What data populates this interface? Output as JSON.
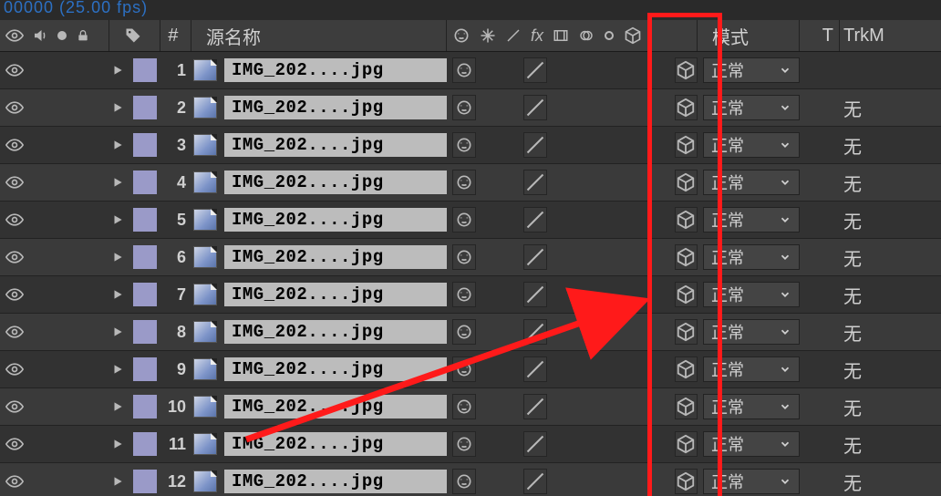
{
  "timecode": "00000 (25.00 fps)",
  "header": {
    "index_label": "#",
    "source_label": "源名称",
    "mode_label": "模式",
    "t_label": "T",
    "trk_label": "TrkM"
  },
  "mode_default": "正常",
  "trk_default": "无",
  "layers": [
    {
      "index": "1",
      "name": "IMG_202....jpg",
      "show_trk": false
    },
    {
      "index": "2",
      "name": "IMG_202....jpg",
      "show_trk": true
    },
    {
      "index": "3",
      "name": "IMG_202....jpg",
      "show_trk": true
    },
    {
      "index": "4",
      "name": "IMG_202....jpg",
      "show_trk": true
    },
    {
      "index": "5",
      "name": "IMG_202....jpg",
      "show_trk": true
    },
    {
      "index": "6",
      "name": "IMG_202....jpg",
      "show_trk": true
    },
    {
      "index": "7",
      "name": "IMG_202....jpg",
      "show_trk": true
    },
    {
      "index": "8",
      "name": "IMG_202....jpg",
      "show_trk": true
    },
    {
      "index": "9",
      "name": "IMG_202....jpg",
      "show_trk": true
    },
    {
      "index": "10",
      "name": "IMG_202....jpg",
      "show_trk": true
    },
    {
      "index": "11",
      "name": "IMG_202....jpg",
      "show_trk": true
    },
    {
      "index": "12",
      "name": "IMG_202....jpg",
      "show_trk": true
    }
  ]
}
